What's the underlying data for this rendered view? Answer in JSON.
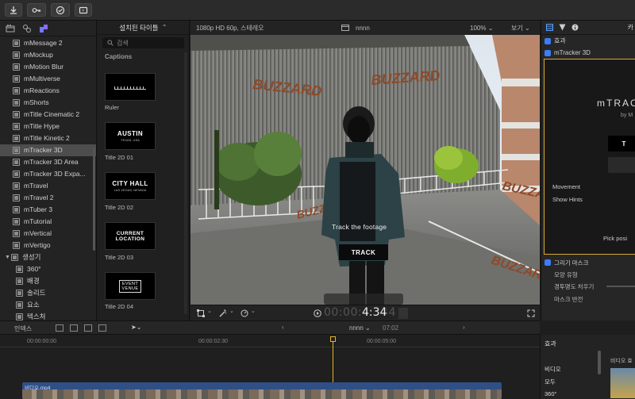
{
  "toolbar": {
    "buttons": [
      "import-icon",
      "keywords-icon",
      "check-icon",
      "share-icon"
    ]
  },
  "sidebar": {
    "items": [
      {
        "label": "mMessage 2"
      },
      {
        "label": "mMockup"
      },
      {
        "label": "mMotion Blur"
      },
      {
        "label": "mMultiverse"
      },
      {
        "label": "mReactions"
      },
      {
        "label": "mShorts"
      },
      {
        "label": "mTitle Cinematic 2"
      },
      {
        "label": "mTitle Hype"
      },
      {
        "label": "mTitle Kinetic 2"
      },
      {
        "label": "mTracker 3D",
        "selected": true
      },
      {
        "label": "mTracker 3D Area"
      },
      {
        "label": "mTracker 3D Expa..."
      },
      {
        "label": "mTravel"
      },
      {
        "label": "mTravel 2"
      },
      {
        "label": "mTuber 3"
      },
      {
        "label": "mTutorial"
      },
      {
        "label": "mVertical"
      },
      {
        "label": "mVertigo"
      }
    ],
    "group": {
      "label": "생성기"
    },
    "sub_items": [
      {
        "label": "360°"
      },
      {
        "label": "배경"
      },
      {
        "label": "솔리드"
      },
      {
        "label": "요소"
      },
      {
        "label": "텍스처"
      }
    ]
  },
  "browser": {
    "title": "설치된 타이틀",
    "search_placeholder": "검색",
    "section": "Captions",
    "items": [
      {
        "label": "Ruler",
        "line1": "",
        "line2": ""
      },
      {
        "label": "Title 2D 01",
        "line1": "AUSTIN",
        "line2": "TEXAS, USA"
      },
      {
        "label": "Title 2D 02",
        "line1": "CITY HALL",
        "line2": "LAS VEGAS, NEVADA"
      },
      {
        "label": "Title 2D 03",
        "line1": "CURRENT",
        "line2": "LOCATION"
      },
      {
        "label": "Title 2D 04",
        "line1": "EVENT",
        "line2": "VENUE"
      }
    ]
  },
  "viewer": {
    "format": "1080p HD 60p, 스테레오",
    "project": "nnnn",
    "zoom": "100%",
    "view": "보기",
    "overlay_text": "Track the footage",
    "track_button": "TRACK",
    "wall_text": "BUZZARD",
    "timecode": "00:00:04:34"
  },
  "inspector": {
    "effects_label": "효과",
    "plugin_name": "mTracker 3D",
    "brand": "mTRAC",
    "by": "by M",
    "movement": "Movement",
    "show_hints": "Show Hints",
    "pick_position": "Pick posi",
    "mask_section": "그리기 마스크",
    "mask_rows": [
      "모양 유형",
      "경투명도 처우기",
      "마스크 반전"
    ],
    "track_btn": "T"
  },
  "timeline": {
    "index_label": "인덱스",
    "project": "nnnn",
    "duration": "07:02",
    "ruler": [
      "00:00:00:00",
      "00:00:02:30",
      "00:00:05:00"
    ],
    "clip_name": "비디오.mp4"
  },
  "effects_browser": {
    "title": "효과",
    "items": [
      "비디오",
      "모두",
      "360°"
    ],
    "thumb_label": "비디오 효"
  }
}
